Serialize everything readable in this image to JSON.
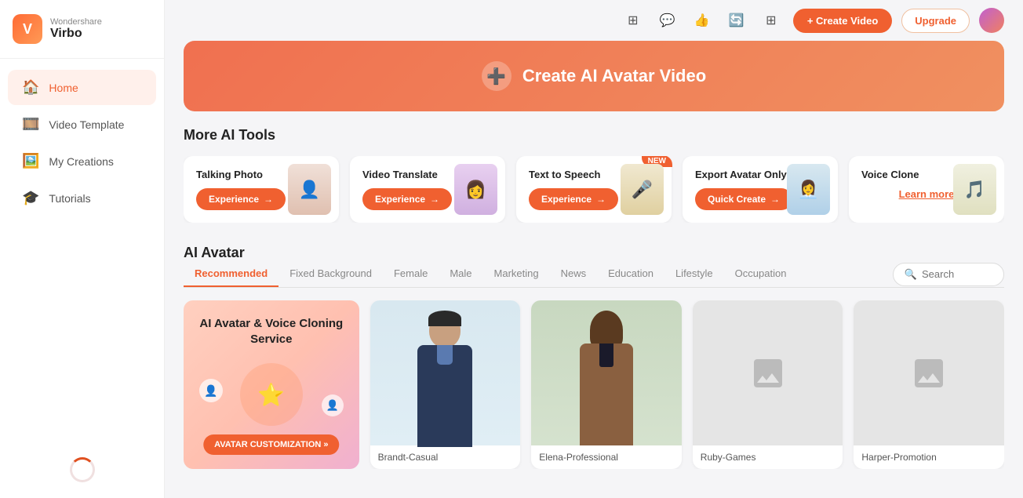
{
  "app": {
    "brand": "Wondershare",
    "name": "Virbo"
  },
  "sidebar": {
    "items": [
      {
        "id": "home",
        "label": "Home",
        "icon": "🏠",
        "active": true
      },
      {
        "id": "video-template",
        "label": "Video Template",
        "icon": "🎬",
        "active": false
      },
      {
        "id": "my-creations",
        "label": "My Creations",
        "icon": "🎓",
        "active": false
      },
      {
        "id": "tutorials",
        "label": "Tutorials",
        "icon": "🎓",
        "active": false
      }
    ]
  },
  "topbar": {
    "create_button": "+ Create Video",
    "upgrade_button": "Upgrade"
  },
  "banner": {
    "icon": "➕",
    "text": "Create AI Avatar Video"
  },
  "more_ai_tools": {
    "section_title": "More AI Tools",
    "tools": [
      {
        "id": "talking-photo",
        "title": "Talking Photo",
        "button_label": "Experience",
        "badge": null
      },
      {
        "id": "video-translate",
        "title": "Video Translate",
        "button_label": "Experience",
        "badge": null
      },
      {
        "id": "text-to-speech",
        "title": "Text to Speech",
        "button_label": "Experience",
        "badge": "NEW"
      },
      {
        "id": "export-avatar",
        "title": "Export Avatar Only",
        "button_label": "Quick Create",
        "badge": null
      },
      {
        "id": "voice-clone",
        "title": "Voice Clone",
        "button_label": "Learn more",
        "badge": null,
        "learn_more": true
      }
    ]
  },
  "ai_avatar": {
    "section_title": "AI Avatar",
    "filter_tabs": [
      {
        "id": "recommended",
        "label": "Recommended",
        "active": true
      },
      {
        "id": "fixed-background",
        "label": "Fixed Background",
        "active": false
      },
      {
        "id": "female",
        "label": "Female",
        "active": false
      },
      {
        "id": "male",
        "label": "Male",
        "active": false
      },
      {
        "id": "marketing",
        "label": "Marketing",
        "active": false
      },
      {
        "id": "news",
        "label": "News",
        "active": false
      },
      {
        "id": "education",
        "label": "Education",
        "active": false
      },
      {
        "id": "lifestyle",
        "label": "Lifestyle",
        "active": false
      },
      {
        "id": "occupation",
        "label": "Occupation",
        "active": false
      }
    ],
    "search_placeholder": "Search",
    "promo_card": {
      "title": "AI Avatar & Voice Cloning Service",
      "button_label": "AVATAR CUSTOMIZATION »"
    },
    "avatars": [
      {
        "id": "brandt-casual",
        "label": "Brandt-Casual",
        "has_image": true,
        "type": "brandt"
      },
      {
        "id": "elena-professional",
        "label": "Elena-Professional",
        "has_image": true,
        "type": "elena"
      },
      {
        "id": "ruby-games",
        "label": "Ruby-Games",
        "has_image": false,
        "type": "placeholder"
      },
      {
        "id": "harper-promotion",
        "label": "Harper-Promotion",
        "has_image": false,
        "type": "placeholder"
      }
    ]
  }
}
